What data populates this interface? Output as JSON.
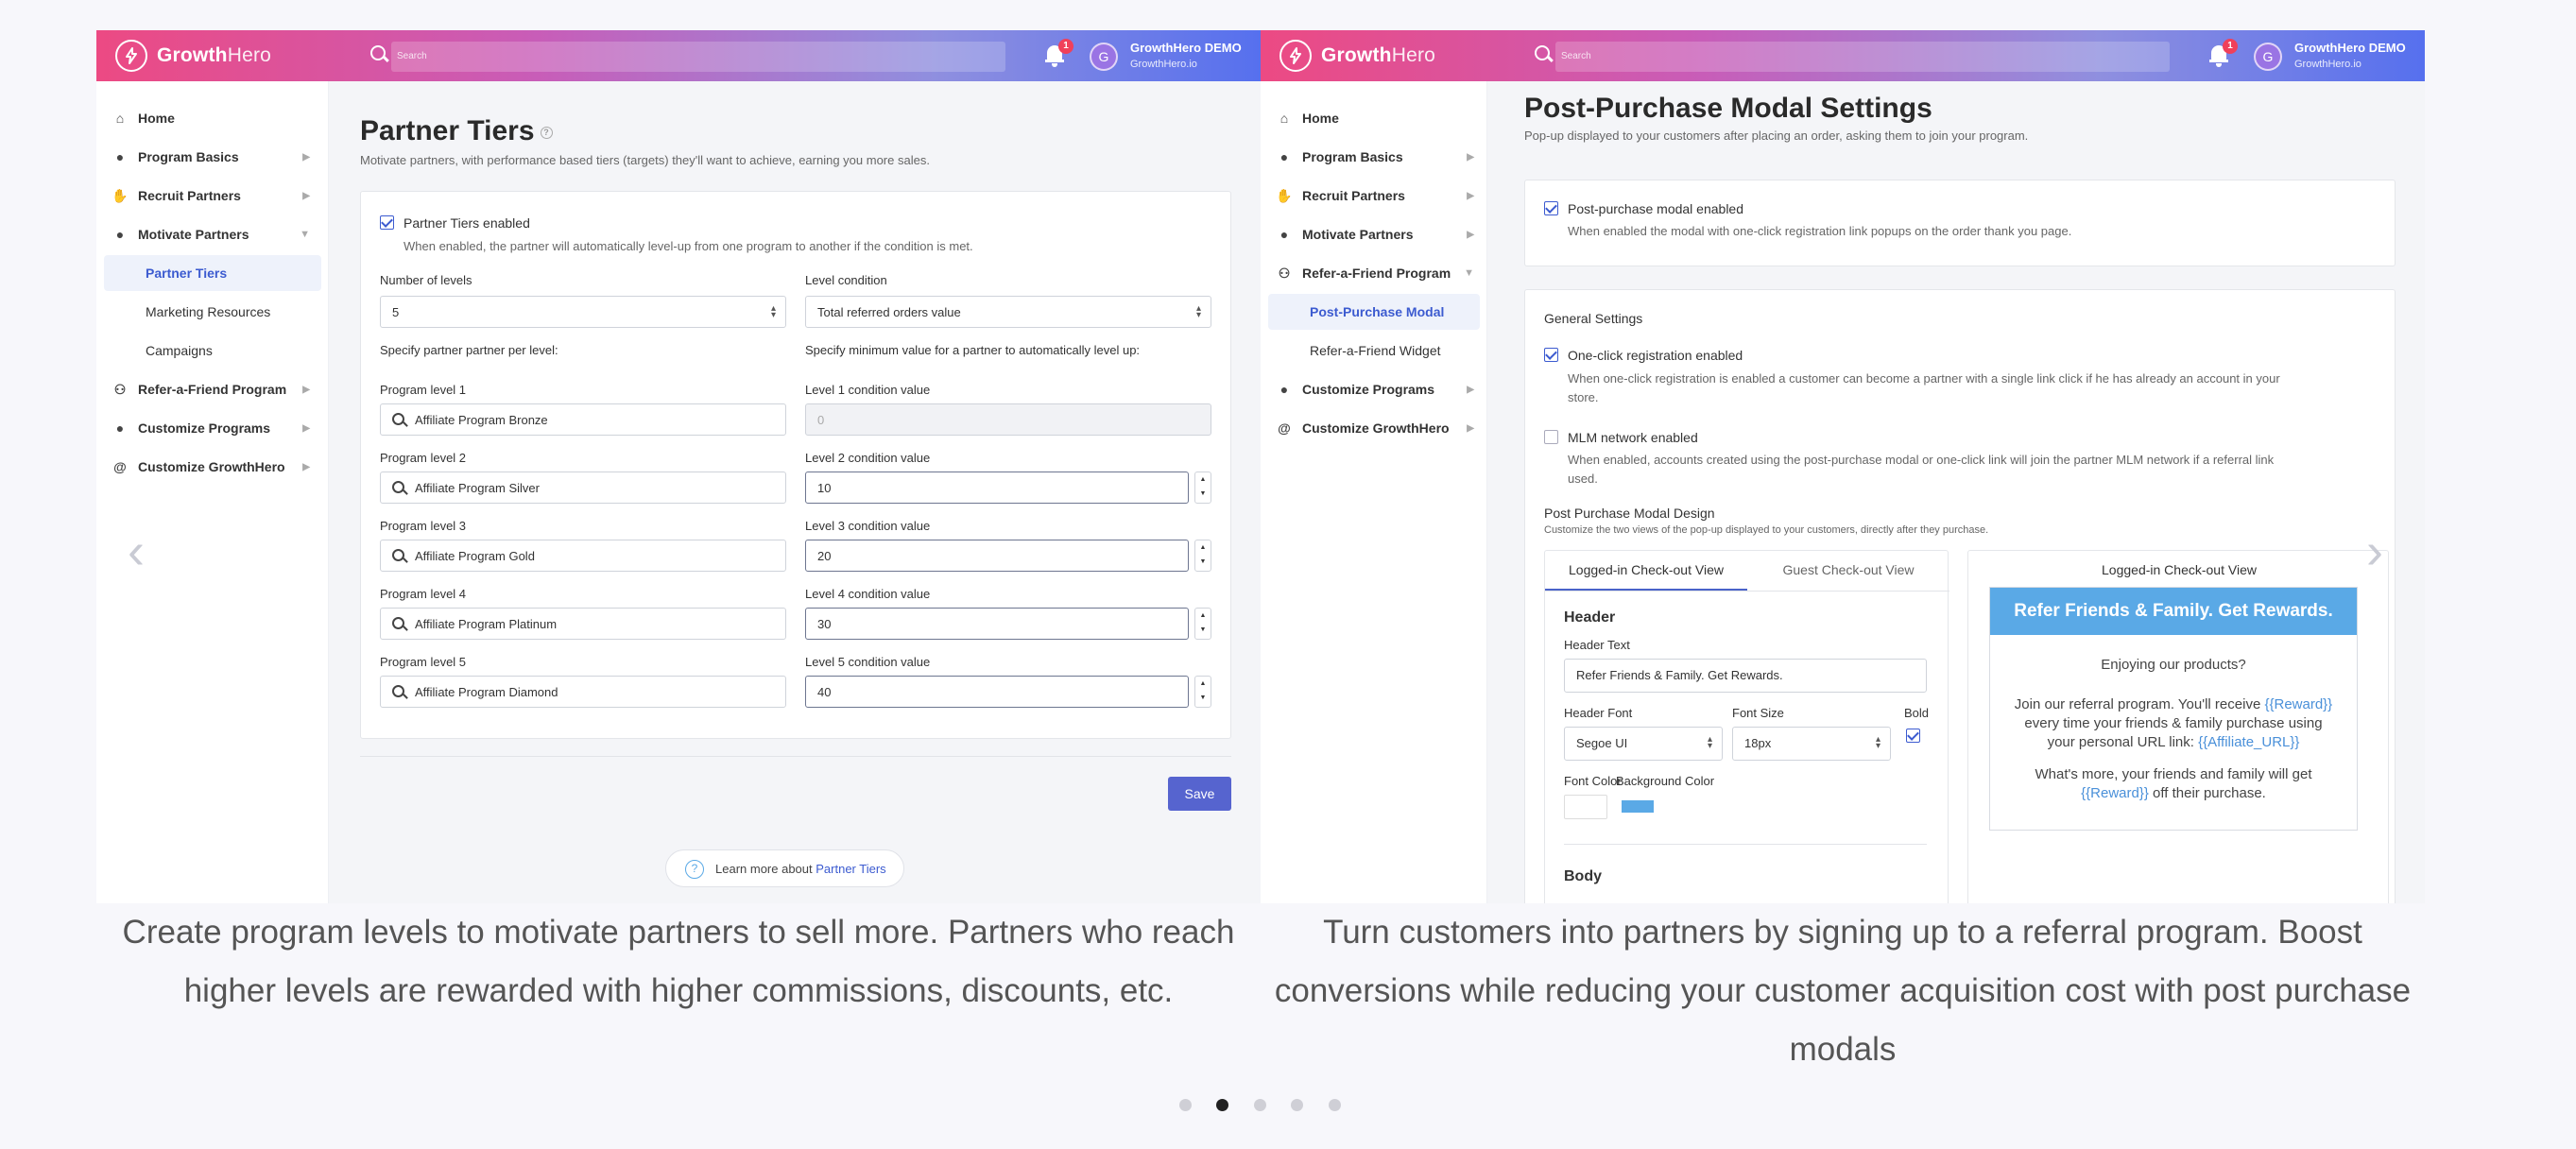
{
  "brand": {
    "name_bold": "Growth",
    "name_rest": "Hero"
  },
  "topbar": {
    "search_placeholder": "Search",
    "notif_count": "1",
    "avatar_letter": "G",
    "user_name": "GrowthHero DEMO",
    "user_site": "GrowthHero.io"
  },
  "slide1": {
    "sidebar": [
      {
        "label": "Home"
      },
      {
        "label": "Program Basics"
      },
      {
        "label": "Recruit Partners"
      },
      {
        "label": "Motivate Partners"
      },
      {
        "label": "Partner Tiers"
      },
      {
        "label": "Marketing Resources"
      },
      {
        "label": "Campaigns"
      },
      {
        "label": "Refer-a-Friend Program"
      },
      {
        "label": "Customize Programs"
      },
      {
        "label": "Customize GrowthHero"
      }
    ],
    "title": "Partner Tiers",
    "description": "Motivate partners, with performance based tiers (targets) they'll want to achieve, earning you more sales.",
    "enabled_label": "Partner Tiers enabled",
    "enabled_help": "When enabled, the partner will automatically level-up from one program to another if the condition is met.",
    "num_levels_label": "Number of levels",
    "num_levels_value": "5",
    "level_condition_label": "Level condition",
    "level_condition_value": "Total referred orders value",
    "left_hint": "Specify partner partner per level:",
    "right_hint": "Specify minimum value for a partner to automatically level up:",
    "levels": [
      {
        "prog_label": "Program level 1",
        "prog_value": "Affiliate Program Bronze",
        "cond_label": "Level 1 condition value",
        "cond_value": "0"
      },
      {
        "prog_label": "Program level 2",
        "prog_value": "Affiliate Program Silver",
        "cond_label": "Level 2 condition value",
        "cond_value": "10"
      },
      {
        "prog_label": "Program level 3",
        "prog_value": "Affiliate Program Gold",
        "cond_label": "Level 3 condition value",
        "cond_value": "20"
      },
      {
        "prog_label": "Program level 4",
        "prog_value": "Affiliate Program Platinum",
        "cond_label": "Level 4 condition value",
        "cond_value": "30"
      },
      {
        "prog_label": "Program level 5",
        "prog_value": "Affiliate Program Diamond",
        "cond_label": "Level 5 condition value",
        "cond_value": "40"
      }
    ],
    "save_label": "Save",
    "learn_prefix": "Learn more about",
    "learn_link": "Partner Tiers"
  },
  "slide2": {
    "sidebar": [
      {
        "label": "Home"
      },
      {
        "label": "Program Basics"
      },
      {
        "label": "Recruit Partners"
      },
      {
        "label": "Motivate Partners"
      },
      {
        "label": "Refer-a-Friend Program"
      },
      {
        "label": "Post-Purchase Modal"
      },
      {
        "label": "Refer-a-Friend Widget"
      },
      {
        "label": "Customize Programs"
      },
      {
        "label": "Customize GrowthHero"
      }
    ],
    "title": "Post-Purchase Modal Settings",
    "description": "Pop-up displayed to your customers after placing an order, asking them to join your program.",
    "modal_enabled_label": "Post-purchase modal enabled",
    "modal_enabled_help": "When enabled the modal with one-click registration link popups on the order thank you page.",
    "general_settings": "General Settings",
    "oneclick_label": "One-click registration enabled",
    "oneclick_help_1": "When one-click registration is enabled a customer can become a partner with a single link click if he has already an account in your",
    "oneclick_help_2": "store.",
    "mlm_label": "MLM network enabled",
    "mlm_help_1": "When enabled, accounts created using the post-purchase modal or one-click link will join the partner MLM network if a referral link",
    "mlm_help_2": "used.",
    "design_title": "Post Purchase Modal Design",
    "design_desc": "Customize the two views of the pop-up displayed to your customers, directly after they purchase.",
    "tab_logged": "Logged-in Check-out View",
    "tab_guest": "Guest Check-out View",
    "header_section": "Header",
    "header_text_label": "Header Text",
    "header_text_value": "Refer Friends & Family. Get Rewards.",
    "header_font_label": "Header Font",
    "header_font_value": "Segoe UI",
    "font_size_label": "Font Size",
    "font_size_value": "18px",
    "bold_label": "Bold",
    "font_color_label": "Font Color",
    "bg_color_label": "Background Color",
    "body_section": "Body",
    "preview_title": "Logged-in Check-out View",
    "preview_header": "Refer Friends & Family. Get Rewards.",
    "preview_line1": "Enjoying our products?",
    "preview_p2_a": "Join our referral program. You'll receive",
    "preview_reward": "{{Reward}}",
    "preview_p2_b": "every time your friends & family purchase using",
    "preview_p2_c": "your personal URL link:",
    "preview_aff": "{{Affiliate_URL}}",
    "preview_p3_a": "What's more, your friends and family will get",
    "preview_p3_b": "off their purchase."
  },
  "captions": {
    "left": "Create program levels to motivate partners to sell more. Partners who reach higher levels are rewarded with higher commissions, discounts, etc.",
    "right": "Turn customers into partners by signing up to a referral program. Boost conversions while reducing your customer acquisition cost with post purchase modals"
  },
  "carousel": {
    "dot_count": 5,
    "active_dot": 2,
    "prev_icon": "chevron-left-icon",
    "next_icon": "chevron-right-icon"
  },
  "colors": {
    "accent": "#3c5bd0",
    "save_button": "#5664cf",
    "preview_header_bg": "#5aa9e6",
    "gradient_start": "#ec4a83",
    "gradient_end": "#5670ee"
  }
}
